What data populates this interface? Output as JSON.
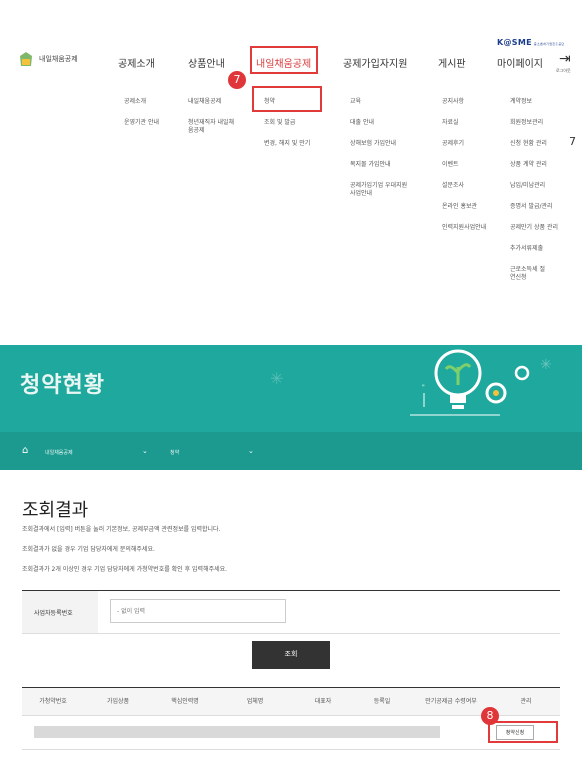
{
  "header": {
    "logo_text": "내일채움공제",
    "nav": [
      "공제소개",
      "상품안내",
      "내일채움공제",
      "공제가입자지원",
      "게시판",
      "마이페이지"
    ],
    "brand": "K@SME",
    "brand_sub": "중소벤처기업진흥공단",
    "login_label": "로그아웃"
  },
  "submenu": {
    "col1": [
      "공제소개",
      "운영기관 안내"
    ],
    "col2": [
      "내일채움공제",
      "청년재직자 내일채움공제"
    ],
    "col3": [
      "청약",
      "조회 및 발급",
      "변경, 해지 및 만기"
    ],
    "col4": [
      "교육",
      "대출 안내",
      "상해보험 가입안내",
      "복지몰 가입안내",
      "공제가입기업 우대지원 사업안내"
    ],
    "col5": [
      "공지사항",
      "자료실",
      "공제후기",
      "이벤트",
      "설문조사",
      "온라인 홍보관",
      "인력지원사업안내"
    ],
    "col6": [
      "계약정보",
      "회원정보관리",
      "신청 현황 관리",
      "상품 계약 관리",
      "납입/미납관리",
      "증명서 발급/관리",
      "공제만기 상품 관리",
      "추가서류제출",
      "근로소득세 절연신청"
    ]
  },
  "markers": {
    "step7": "7",
    "step8": "8",
    "edge": "7"
  },
  "banner": {
    "title": "청약현황",
    "crumb1": "내일채움공제",
    "crumb2": "청약"
  },
  "result": {
    "title": "조회결과",
    "notes": [
      "조회결과에서 [입력] 버튼을 눌러 기본정보, 공제부금액 관련정보를 입력합니다.",
      "조회결과가 없을 경우 기업 담당자에게 문의해주세요.",
      "조회결과가 2개 이상인 경우 기업 담당자에게 가청약번호를 확인 후 입력해주세요."
    ],
    "search_label": "사업자등록번호",
    "search_placeholder": "- 없이 입력",
    "query_button": "조회",
    "columns": [
      "가청약번호",
      "가입상품",
      "핵심인력명",
      "업체명",
      "대표자",
      "등록일",
      "만기공제금 수령여부",
      "관리"
    ],
    "apply_button": "청약신청"
  },
  "colors": {
    "accent": "#e03a3a",
    "banner": "#1fa89d",
    "brand": "#1b3d8f"
  }
}
